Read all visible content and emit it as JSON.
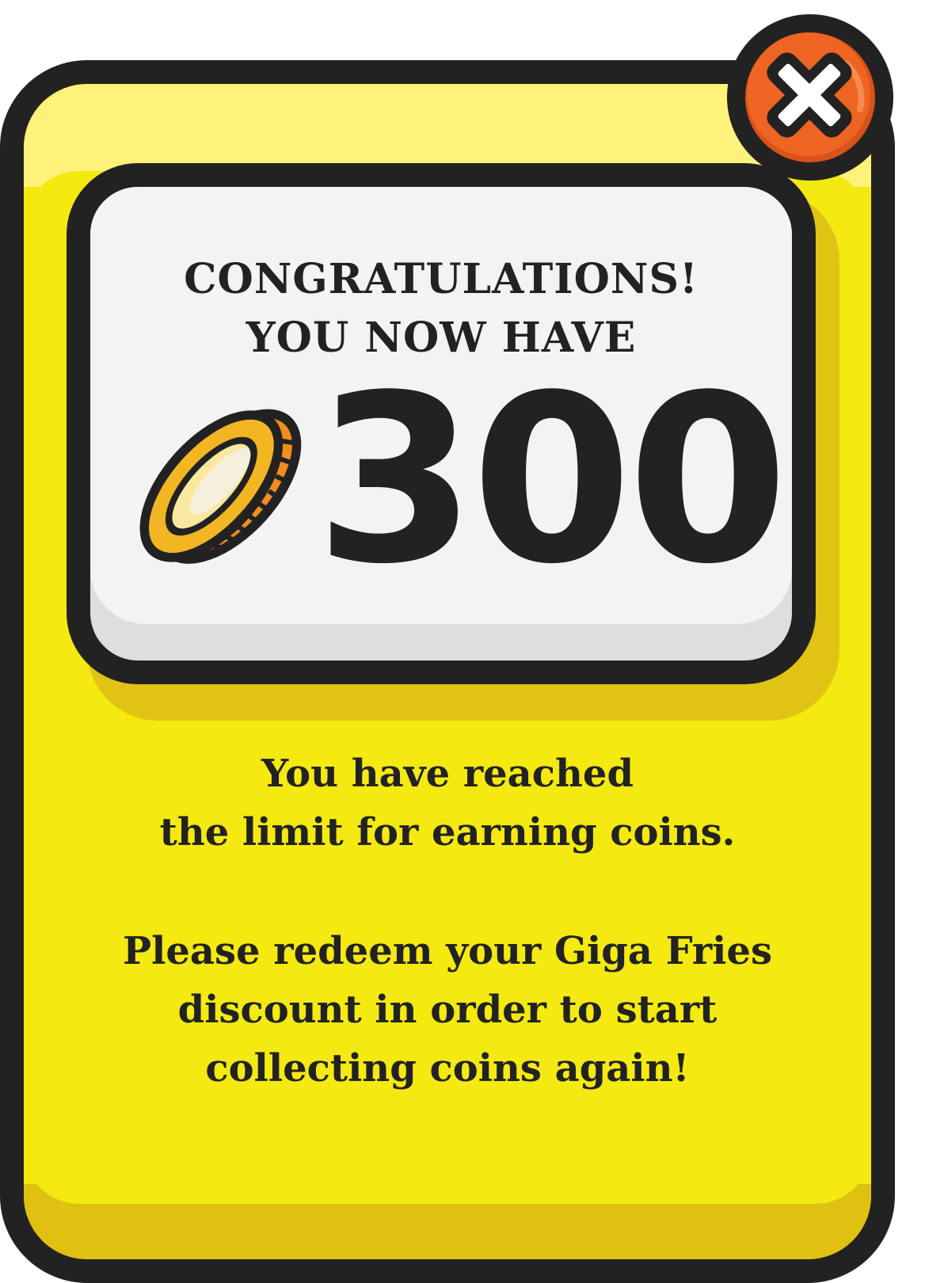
{
  "dialog": {
    "title_line1": "CONGRATULATIONS!",
    "title_line2": "YOU NOW HAVE",
    "coin_icon": "coin-icon",
    "coin_count": "300",
    "message_limit_line1": "You have reached",
    "message_limit_line2": "the limit for earning coins.",
    "message_redeem_line1": "Please redeem your Giga Fries",
    "message_redeem_line2": "discount in order to start",
    "message_redeem_line3": "collecting coins again!"
  },
  "close_button": {
    "icon": "close-icon"
  },
  "colors": {
    "card_yellow": "#f4e910",
    "card_top_highlight": "#fff27a",
    "card_bottom_shade": "#e0c111",
    "outline": "#222222",
    "panel_face": "#f3f3f3",
    "panel_shade": "#dedede",
    "close_orange": "#ee6422",
    "coin_gold": "#f2b623"
  }
}
